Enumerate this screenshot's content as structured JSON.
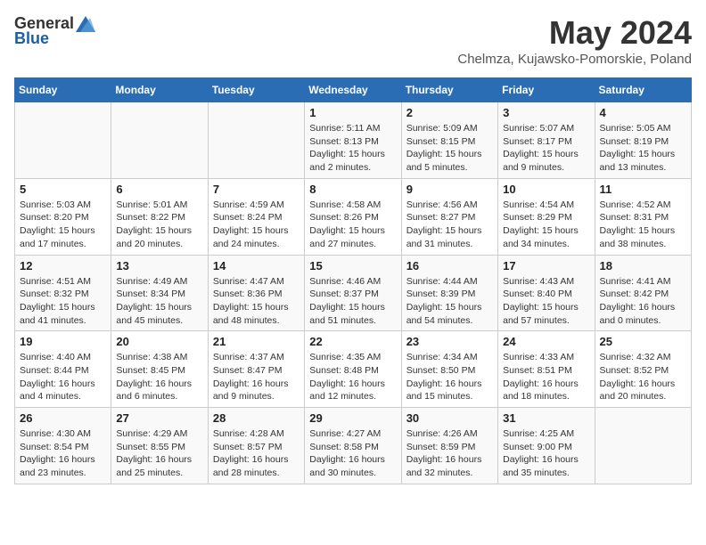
{
  "header": {
    "logo_general": "General",
    "logo_blue": "Blue",
    "month_year": "May 2024",
    "location": "Chelmza, Kujawsko-Pomorskie, Poland"
  },
  "days_of_week": [
    "Sunday",
    "Monday",
    "Tuesday",
    "Wednesday",
    "Thursday",
    "Friday",
    "Saturday"
  ],
  "weeks": [
    [
      {
        "day": "",
        "info": ""
      },
      {
        "day": "",
        "info": ""
      },
      {
        "day": "",
        "info": ""
      },
      {
        "day": "1",
        "info": "Sunrise: 5:11 AM\nSunset: 8:13 PM\nDaylight: 15 hours\nand 2 minutes."
      },
      {
        "day": "2",
        "info": "Sunrise: 5:09 AM\nSunset: 8:15 PM\nDaylight: 15 hours\nand 5 minutes."
      },
      {
        "day": "3",
        "info": "Sunrise: 5:07 AM\nSunset: 8:17 PM\nDaylight: 15 hours\nand 9 minutes."
      },
      {
        "day": "4",
        "info": "Sunrise: 5:05 AM\nSunset: 8:19 PM\nDaylight: 15 hours\nand 13 minutes."
      }
    ],
    [
      {
        "day": "5",
        "info": "Sunrise: 5:03 AM\nSunset: 8:20 PM\nDaylight: 15 hours\nand 17 minutes."
      },
      {
        "day": "6",
        "info": "Sunrise: 5:01 AM\nSunset: 8:22 PM\nDaylight: 15 hours\nand 20 minutes."
      },
      {
        "day": "7",
        "info": "Sunrise: 4:59 AM\nSunset: 8:24 PM\nDaylight: 15 hours\nand 24 minutes."
      },
      {
        "day": "8",
        "info": "Sunrise: 4:58 AM\nSunset: 8:26 PM\nDaylight: 15 hours\nand 27 minutes."
      },
      {
        "day": "9",
        "info": "Sunrise: 4:56 AM\nSunset: 8:27 PM\nDaylight: 15 hours\nand 31 minutes."
      },
      {
        "day": "10",
        "info": "Sunrise: 4:54 AM\nSunset: 8:29 PM\nDaylight: 15 hours\nand 34 minutes."
      },
      {
        "day": "11",
        "info": "Sunrise: 4:52 AM\nSunset: 8:31 PM\nDaylight: 15 hours\nand 38 minutes."
      }
    ],
    [
      {
        "day": "12",
        "info": "Sunrise: 4:51 AM\nSunset: 8:32 PM\nDaylight: 15 hours\nand 41 minutes."
      },
      {
        "day": "13",
        "info": "Sunrise: 4:49 AM\nSunset: 8:34 PM\nDaylight: 15 hours\nand 45 minutes."
      },
      {
        "day": "14",
        "info": "Sunrise: 4:47 AM\nSunset: 8:36 PM\nDaylight: 15 hours\nand 48 minutes."
      },
      {
        "day": "15",
        "info": "Sunrise: 4:46 AM\nSunset: 8:37 PM\nDaylight: 15 hours\nand 51 minutes."
      },
      {
        "day": "16",
        "info": "Sunrise: 4:44 AM\nSunset: 8:39 PM\nDaylight: 15 hours\nand 54 minutes."
      },
      {
        "day": "17",
        "info": "Sunrise: 4:43 AM\nSunset: 8:40 PM\nDaylight: 15 hours\nand 57 minutes."
      },
      {
        "day": "18",
        "info": "Sunrise: 4:41 AM\nSunset: 8:42 PM\nDaylight: 16 hours\nand 0 minutes."
      }
    ],
    [
      {
        "day": "19",
        "info": "Sunrise: 4:40 AM\nSunset: 8:44 PM\nDaylight: 16 hours\nand 4 minutes."
      },
      {
        "day": "20",
        "info": "Sunrise: 4:38 AM\nSunset: 8:45 PM\nDaylight: 16 hours\nand 6 minutes."
      },
      {
        "day": "21",
        "info": "Sunrise: 4:37 AM\nSunset: 8:47 PM\nDaylight: 16 hours\nand 9 minutes."
      },
      {
        "day": "22",
        "info": "Sunrise: 4:35 AM\nSunset: 8:48 PM\nDaylight: 16 hours\nand 12 minutes."
      },
      {
        "day": "23",
        "info": "Sunrise: 4:34 AM\nSunset: 8:50 PM\nDaylight: 16 hours\nand 15 minutes."
      },
      {
        "day": "24",
        "info": "Sunrise: 4:33 AM\nSunset: 8:51 PM\nDaylight: 16 hours\nand 18 minutes."
      },
      {
        "day": "25",
        "info": "Sunrise: 4:32 AM\nSunset: 8:52 PM\nDaylight: 16 hours\nand 20 minutes."
      }
    ],
    [
      {
        "day": "26",
        "info": "Sunrise: 4:30 AM\nSunset: 8:54 PM\nDaylight: 16 hours\nand 23 minutes."
      },
      {
        "day": "27",
        "info": "Sunrise: 4:29 AM\nSunset: 8:55 PM\nDaylight: 16 hours\nand 25 minutes."
      },
      {
        "day": "28",
        "info": "Sunrise: 4:28 AM\nSunset: 8:57 PM\nDaylight: 16 hours\nand 28 minutes."
      },
      {
        "day": "29",
        "info": "Sunrise: 4:27 AM\nSunset: 8:58 PM\nDaylight: 16 hours\nand 30 minutes."
      },
      {
        "day": "30",
        "info": "Sunrise: 4:26 AM\nSunset: 8:59 PM\nDaylight: 16 hours\nand 32 minutes."
      },
      {
        "day": "31",
        "info": "Sunrise: 4:25 AM\nSunset: 9:00 PM\nDaylight: 16 hours\nand 35 minutes."
      },
      {
        "day": "",
        "info": ""
      }
    ]
  ]
}
